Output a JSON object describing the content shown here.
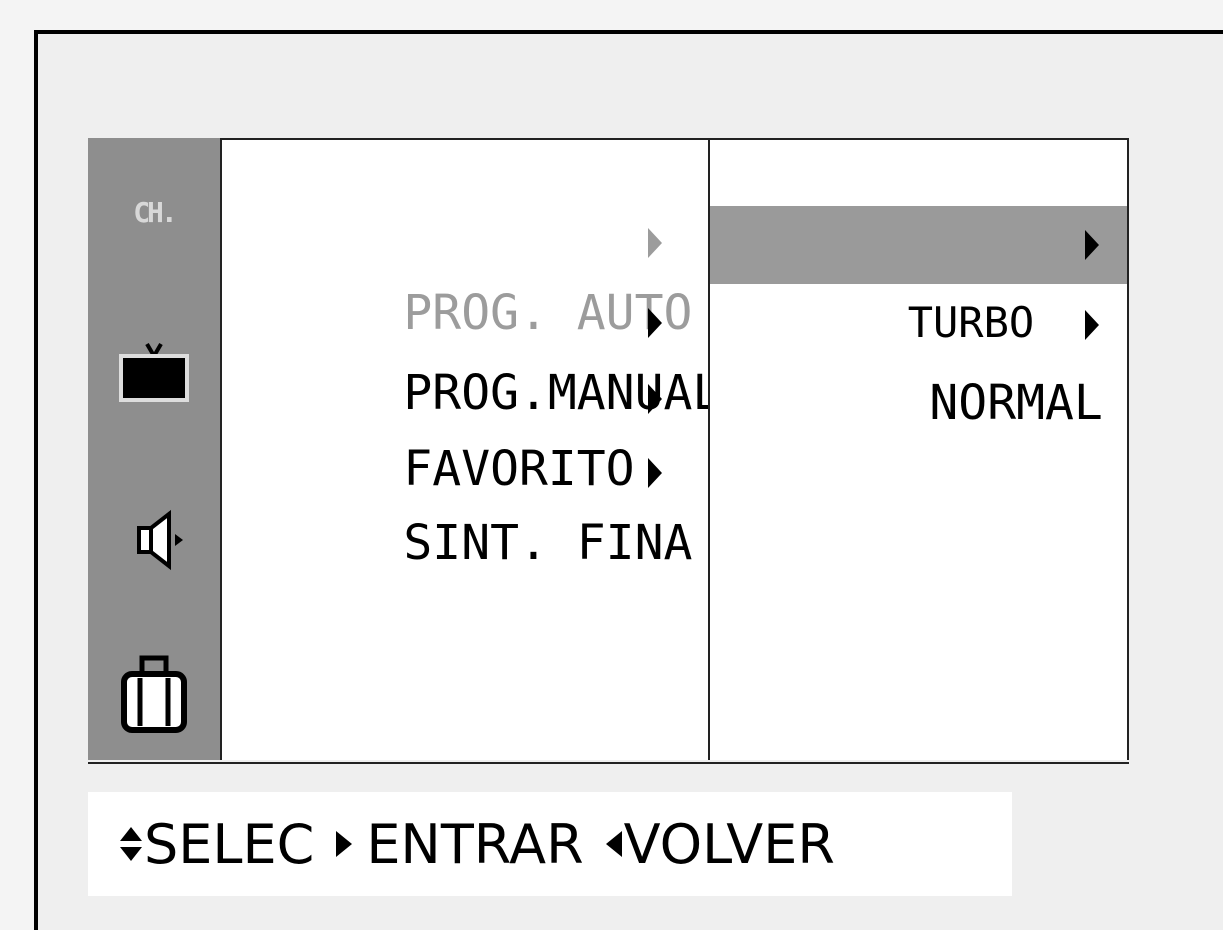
{
  "sidebar": {
    "channel_label": "CH.",
    "icons": [
      "tv-icon",
      "speaker-icon",
      "briefcase-icon"
    ]
  },
  "menu": {
    "items": [
      {
        "label": "PROG. AUTO",
        "state": "dimmed"
      },
      {
        "label": "PROG.MANUAL",
        "state": "normal"
      },
      {
        "label": "FAVORITO",
        "state": "normal"
      },
      {
        "label": "SINT. FINA",
        "state": "normal"
      }
    ]
  },
  "submenu": {
    "items": [
      {
        "label": "TURBO",
        "state": "selected"
      },
      {
        "label": "NORMAL",
        "state": "normal"
      }
    ]
  },
  "footer": {
    "select_label": "SELEC",
    "enter_label": "ENTRAR",
    "back_label": "VOLVER"
  },
  "colors": {
    "sidebar": "#8e8e8e",
    "selected": "#9a9a9a",
    "dimmed_text": "#9c9c9c"
  }
}
